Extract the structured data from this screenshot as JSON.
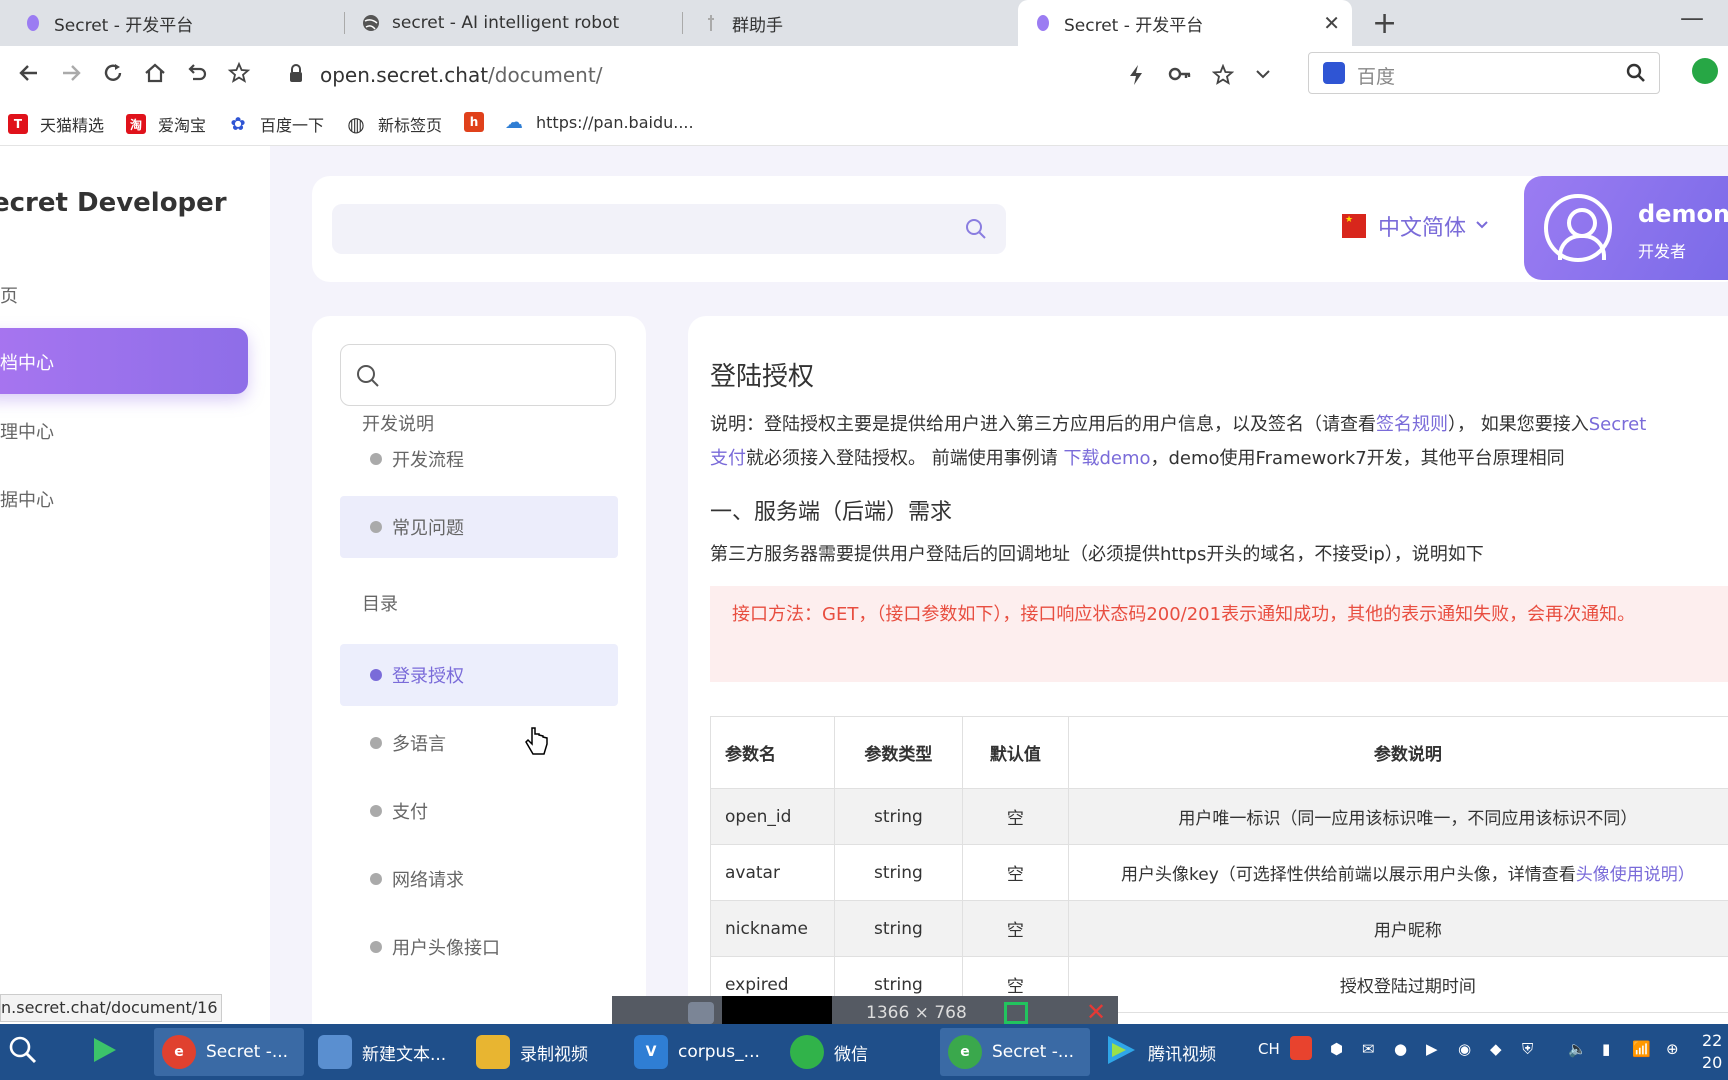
{
  "browser": {
    "tabs": [
      {
        "title": "Secret - 开发平台"
      },
      {
        "title": "secret - AI intelligent robot"
      },
      {
        "title": "群助手"
      },
      {
        "title": "Secret - 开发平台"
      }
    ],
    "url_host": "open.secret.chat",
    "url_path": "/document/",
    "search_placeholder": "百度",
    "bookmarks": [
      {
        "label": "天猫精选",
        "icon": "T",
        "color": "#e0121b"
      },
      {
        "label": "爱淘宝",
        "icon": "淘",
        "color": "#e0121b"
      },
      {
        "label": "百度一下",
        "icon": "✿",
        "color": "#2f55d4"
      },
      {
        "label": "新标签页",
        "icon": "◍",
        "color": "#333333"
      },
      {
        "label": "",
        "icon": "h",
        "color": "#e0411b"
      },
      {
        "label": "https://pan.baidu....",
        "icon": "☁",
        "color": "#2f7ed4"
      }
    ],
    "status_url": "n.secret.chat/document/16"
  },
  "sidebar": {
    "brand": "ecret Developer",
    "items": [
      {
        "label": "页"
      },
      {
        "label": "档中心"
      },
      {
        "label": "理中心"
      },
      {
        "label": "据中心"
      }
    ]
  },
  "header": {
    "language": "中文简体",
    "user_name": "demon",
    "user_role": "开发者"
  },
  "doc_nav": {
    "section1": "开发说明",
    "section1_items": [
      {
        "label": "开发流程"
      },
      {
        "label": "常见问题"
      }
    ],
    "section2": "目录",
    "section2_items": [
      {
        "label": "登录授权"
      },
      {
        "label": "多语言"
      },
      {
        "label": "支付"
      },
      {
        "label": "网络请求"
      },
      {
        "label": "用户头像接口"
      }
    ]
  },
  "content": {
    "title": "登陆授权",
    "p1_a": "说明：登陆授权主要是提供给用户进入第三方应用后的用户信息，以及签名（请查看",
    "p1_link": "签名规则",
    "p1_b": "），  如果您要接入",
    "p1_link2": "Secret",
    "p2_link": "支付",
    "p2_a": "就必须接入登陆授权。  前端使用事例请 ",
    "p2_link2": "下载demo",
    "p2_b": "，demo使用Framework7开发，其他平台原理相同",
    "h2": "一、服务端（后端）需求",
    "p3": "第三方服务器需要提供用户登陆后的回调地址（必须提供https开头的域名，不接受ip），说明如下",
    "alert": "接口方法：GET，（接口参数如下），接口响应状态码200/201表示通知成功，其他的表示通知失败，会再次通知。",
    "table": {
      "headers": [
        "参数名",
        "参数类型",
        "默认值",
        "参数说明"
      ],
      "rows": [
        {
          "name": "open_id",
          "type": "string",
          "default": "空",
          "desc": "用户唯一标识（同一应用该标识唯一，不同应用该标识不同）",
          "link": ""
        },
        {
          "name": "avatar",
          "type": "string",
          "default": "空",
          "desc": "用户头像key（可选择性供给前端以展示用户头像，详情查看",
          "link": "头像使用说明）"
        },
        {
          "name": "nickname",
          "type": "string",
          "default": "空",
          "desc": "用户昵称",
          "link": ""
        },
        {
          "name": "expired",
          "type": "string",
          "default": "空",
          "desc": "授权登陆过期时间",
          "link": ""
        }
      ]
    }
  },
  "overlay": {
    "resolution": "1366 × 768"
  },
  "taskbar": {
    "items": [
      {
        "label": "Secret -...",
        "color": "#e0412f"
      },
      {
        "label": "新建文本...",
        "color": "#5a8fd0"
      },
      {
        "label": "录制视频",
        "color": "#e8b531"
      },
      {
        "label": "corpus_...",
        "color": "#2f7ed4"
      },
      {
        "label": "微信",
        "color": "#31b34a"
      },
      {
        "label": "Secret -...",
        "color": "#3aa84c"
      },
      {
        "label": "腾讯视频",
        "color": "#2fa6e8"
      }
    ],
    "tray_lang": "CH",
    "clock_time": "22",
    "clock_date": "20"
  }
}
